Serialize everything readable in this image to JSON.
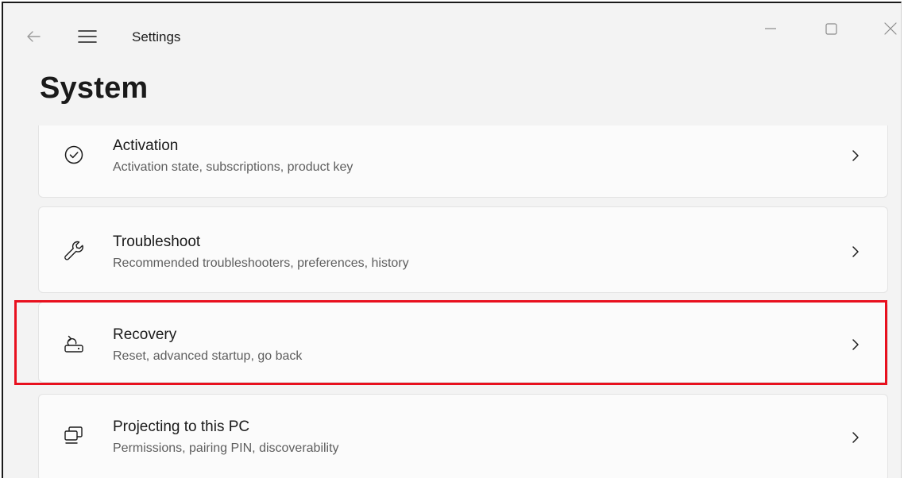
{
  "window": {
    "app_title": "Settings",
    "controls": {
      "back": "back-arrow-icon",
      "menu": "hamburger-menu-icon",
      "minimize": "minimize-icon",
      "maximize": "maximize-icon",
      "close": "close-icon"
    }
  },
  "page": {
    "title": "System"
  },
  "items": [
    {
      "title": "Activation",
      "subtitle": "Activation state, subscriptions, product key",
      "icon": "check-circle-icon"
    },
    {
      "title": "Troubleshoot",
      "subtitle": "Recommended troubleshooters, preferences, history",
      "icon": "wrench-icon"
    },
    {
      "title": "Recovery",
      "subtitle": "Reset, advanced startup, go back",
      "icon": "recovery-icon",
      "highlighted": true
    },
    {
      "title": "Projecting to this PC",
      "subtitle": "Permissions, pairing PIN, discoverability",
      "icon": "projecting-icon"
    }
  ],
  "colors": {
    "background": "#f3f3f3",
    "card": "#fbfbfb",
    "highlight": "#e8101e",
    "text_primary": "#1a1a1a",
    "text_secondary": "#5e5e5e"
  }
}
